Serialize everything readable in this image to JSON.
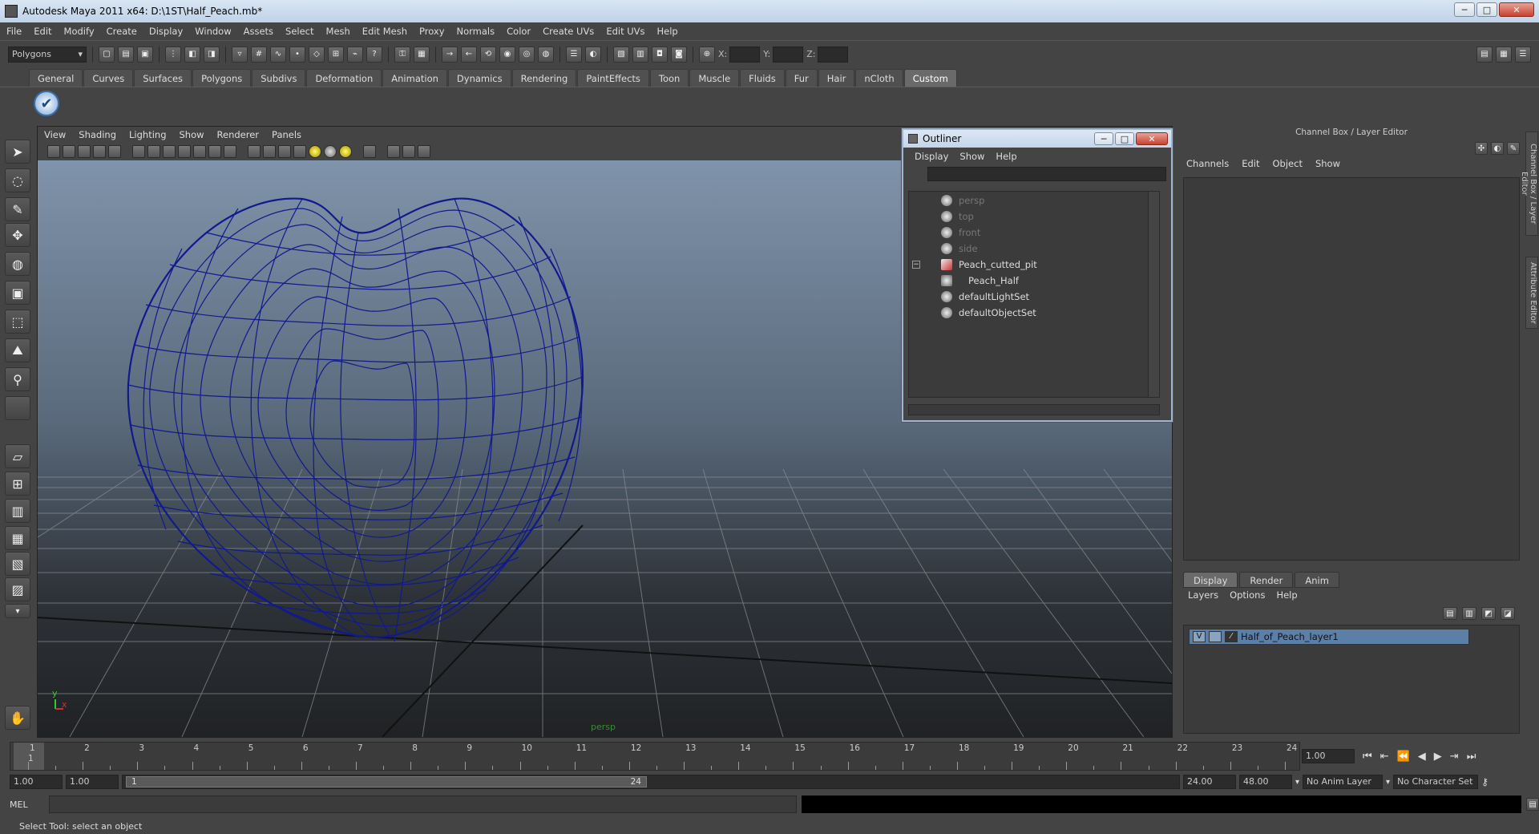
{
  "window": {
    "title": "Autodesk Maya 2011 x64: D:\\1ST\\Half_Peach.mb*",
    "minimize": "─",
    "maximize": "□",
    "close": "✕"
  },
  "menu": [
    "File",
    "Edit",
    "Modify",
    "Create",
    "Display",
    "Window",
    "Assets",
    "Select",
    "Mesh",
    "Edit Mesh",
    "Proxy",
    "Normals",
    "Color",
    "Create UVs",
    "Edit UVs",
    "Help"
  ],
  "toolbar": {
    "mode": "Polygons",
    "x_label": "X:",
    "y_label": "Y:",
    "z_label": "Z:"
  },
  "shelf_tabs": [
    "General",
    "Curves",
    "Surfaces",
    "Polygons",
    "Subdivs",
    "Deformation",
    "Animation",
    "Dynamics",
    "Rendering",
    "PaintEffects",
    "Toon",
    "Muscle",
    "Fluids",
    "Fur",
    "Hair",
    "nCloth",
    "Custom"
  ],
  "shelf_active": "Custom",
  "viewport": {
    "menu": [
      "View",
      "Shading",
      "Lighting",
      "Show",
      "Renderer",
      "Panels"
    ],
    "camera_label": "persp",
    "axis_y": "y",
    "axis_x": "x"
  },
  "outliner": {
    "title": "Outliner",
    "menu": [
      "Display",
      "Show",
      "Help"
    ],
    "items": [
      {
        "label": "persp",
        "dim": true
      },
      {
        "label": "top",
        "dim": true
      },
      {
        "label": "front",
        "dim": true
      },
      {
        "label": "side",
        "dim": true
      },
      {
        "label": "Peach_cutted_pit",
        "dim": false
      },
      {
        "label": "Peach_Half",
        "dim": false
      },
      {
        "label": "defaultLightSet",
        "dim": false
      },
      {
        "label": "defaultObjectSet",
        "dim": false
      }
    ]
  },
  "channel_box": {
    "title": "Channel Box / Layer Editor",
    "menu": [
      "Channels",
      "Edit",
      "Object",
      "Show"
    ],
    "layer_tabs": [
      "Display",
      "Render",
      "Anim"
    ],
    "layer_tab_active": "Display",
    "layer_menu": [
      "Layers",
      "Options",
      "Help"
    ],
    "layer_name": "Half_of_Peach_layer1",
    "layer_visible": "V"
  },
  "side_tabs": [
    "Channel Box / Layer Editor",
    "Attribute Editor"
  ],
  "time_slider": {
    "ticks": [
      "1",
      "2",
      "3",
      "4",
      "5",
      "6",
      "7",
      "8",
      "9",
      "10",
      "11",
      "12",
      "13",
      "14",
      "15",
      "16",
      "17",
      "18",
      "19",
      "20",
      "21",
      "22",
      "23",
      "24"
    ],
    "current_frame": "1",
    "current_time_field": "1.00"
  },
  "range": {
    "start": "1.00",
    "playback_start": "1.00",
    "handle_start": "1",
    "handle_end": "24",
    "playback_end": "24.00",
    "end": "48.00",
    "anim_layer": "No Anim Layer",
    "char_set": "No Character Set"
  },
  "command": {
    "label": "MEL",
    "help": "Select Tool: select an object"
  }
}
